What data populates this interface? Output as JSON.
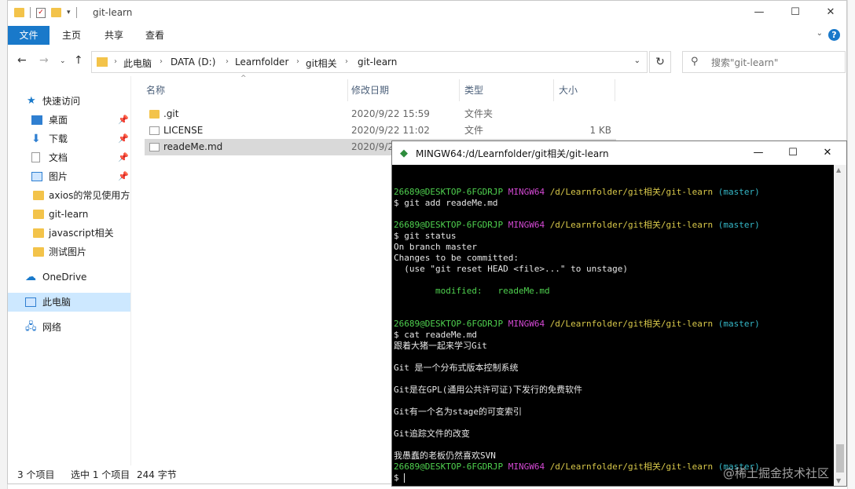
{
  "window": {
    "title": "git-learn",
    "minimize": "—",
    "maximize": "☐",
    "close": "✕"
  },
  "ribbon": {
    "tabs": [
      {
        "label": "文件",
        "active": true
      },
      {
        "label": "主页",
        "active": false
      },
      {
        "label": "共享",
        "active": false
      },
      {
        "label": "查看",
        "active": false
      }
    ],
    "help": "?"
  },
  "address": {
    "crumbs": [
      "此电脑",
      "DATA (D:)",
      "Learnfolder",
      "git相关",
      "git-learn"
    ]
  },
  "search": {
    "placeholder": "搜索\"git-learn\""
  },
  "sidebar": {
    "items": [
      {
        "label": "快速访问"
      },
      {
        "label": "桌面"
      },
      {
        "label": "下载"
      },
      {
        "label": "文档"
      },
      {
        "label": "图片"
      },
      {
        "label": "axios的常见使用方式"
      },
      {
        "label": "git-learn"
      },
      {
        "label": "javascript相关"
      },
      {
        "label": "测试图片"
      },
      {
        "label": "OneDrive"
      },
      {
        "label": "此电脑"
      },
      {
        "label": "网络"
      }
    ]
  },
  "columns": {
    "name": "名称",
    "date": "修改日期",
    "type": "类型",
    "size": "大小"
  },
  "files": [
    {
      "name": ".git",
      "date": "2020/9/22 15:59",
      "type": "文件夹",
      "size": ""
    },
    {
      "name": "LICENSE",
      "date": "2020/9/22 11:02",
      "type": "文件",
      "size": "1 KB"
    },
    {
      "name": "readeMe.md",
      "date": "2020/9/2",
      "type": "",
      "size": ""
    }
  ],
  "status": {
    "count": "3 个项目",
    "selected": "选中 1 个项目",
    "bytes": "244 字节"
  },
  "terminal": {
    "title": "MINGW64:/d/Learnfolder/git相关/git-learn",
    "prompt_user": "26689@DESKTOP-6FGDRJP",
    "prompt_env": "MINGW64",
    "prompt_path": "/d/Learnfolder/git相关/git-learn",
    "prompt_branch": "(master)",
    "cmd1": "$ git add readeMe.md",
    "cmd2": "$ git status",
    "out2_1": "On branch master",
    "out2_2": "Changes to be committed:",
    "out2_3": "  (use \"git reset HEAD <file>...\" to unstage)",
    "out2_4": "        modified:   readeMe.md",
    "cmd3": "$ cat readeMe.md",
    "out3_1": "跟着大猪一起来学习Git",
    "out3_2": "Git 是一个分布式版本控制系统",
    "out3_3": "Git是在GPL(通用公共许可证)下发行的免费软件",
    "out3_4": "Git有一个名为stage的可变索引",
    "out3_5": "Git追踪文件的改变",
    "out3_6": "我愚蠢的老板仍然喜欢SVN",
    "cmd4": "$ "
  },
  "watermark": "@稀土掘金技术社区",
  "colors": {
    "accent": "#1979ca",
    "selected_nav": "#cde8ff",
    "terminal_bg": "#000000"
  }
}
